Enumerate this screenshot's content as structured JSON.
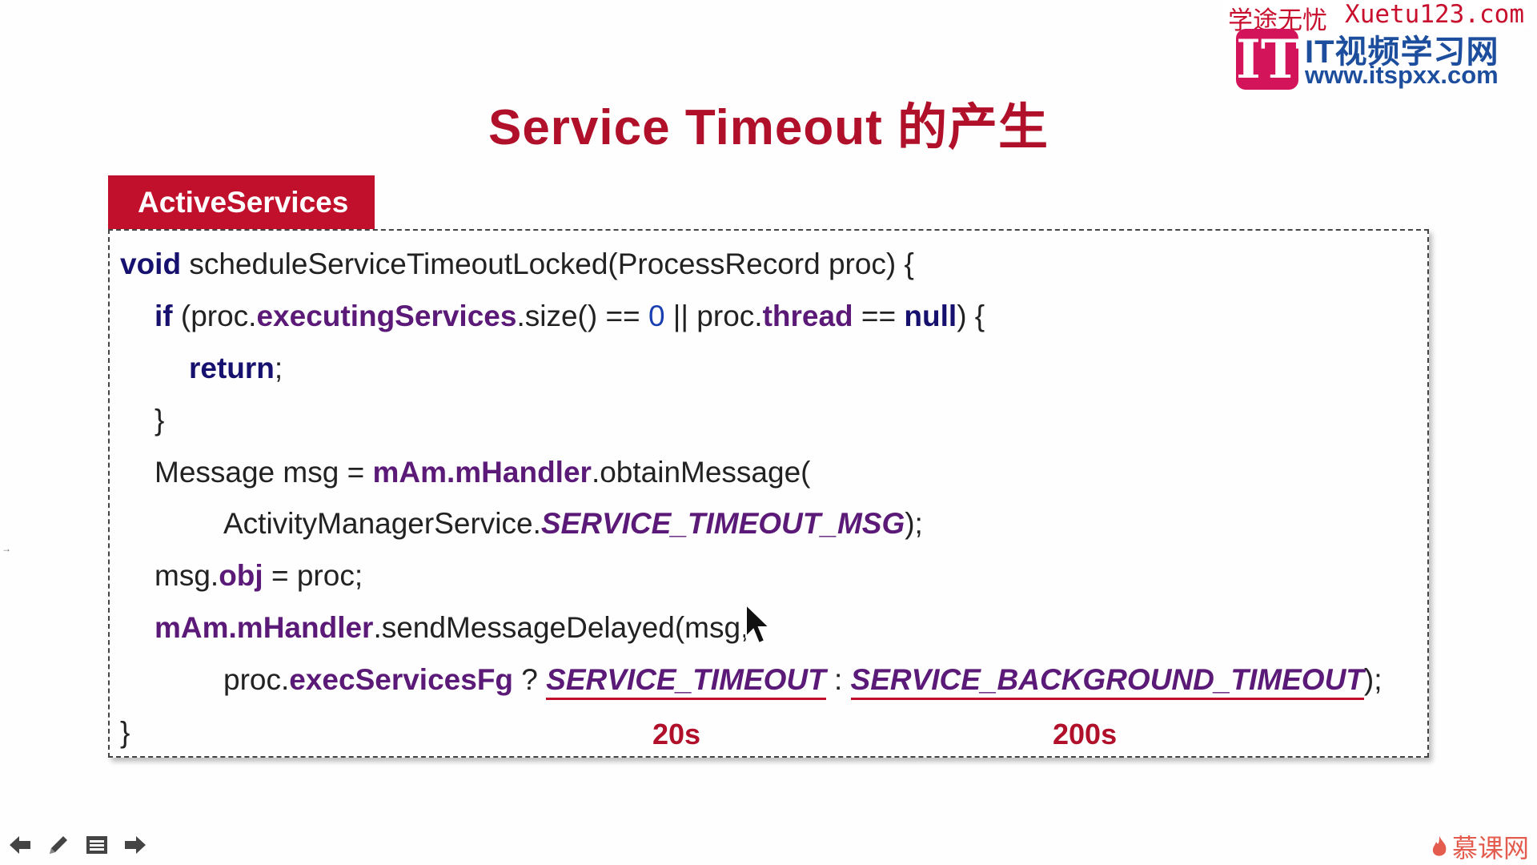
{
  "watermark": {
    "top_cn": "学途无忧",
    "top_url": "Xuetu123.com",
    "logo_letter": "IT",
    "logo_cn": "IT视频学习网",
    "logo_url": "www.itspxx.com"
  },
  "slide": {
    "title": "Service Timeout 的产生",
    "class_tab": "ActiveServices",
    "annotations": {
      "fg_timeout": "20s",
      "bg_timeout": "200s"
    }
  },
  "code": {
    "l1_kw": "void",
    "l1_rest": " scheduleServiceTimeoutLocked(ProcessRecord proc) {",
    "l2_kw": "if",
    "l2_a": " (proc.",
    "l2_fld": "executingServices",
    "l2_b": ".size() == ",
    "l2_num": "0",
    "l2_c": " || proc.",
    "l2_fld2": "thread",
    "l2_d": " == ",
    "l2_kw2": "null",
    "l2_e": ") {",
    "l3_kw": "return",
    "l3_rest": ";",
    "l4": "}",
    "l5_a": "Message msg = ",
    "l5_fld": "mAm.mHandler",
    "l5_b": ".obtainMessage(",
    "l6_a": "ActivityManagerService.",
    "l6_cst": "SERVICE_TIMEOUT_MSG",
    "l6_b": ");",
    "l7_a": "msg.",
    "l7_fld": "obj",
    "l7_b": " = proc;",
    "l8_fld": "mAm.mHandler",
    "l8_b": ".sendMessageDelayed(msg,",
    "l9_a": "proc.",
    "l9_fld": "execServicesFg",
    "l9_b": " ? ",
    "l9_cst1": "SERVICE_TIMEOUT",
    "l9_c": " : ",
    "l9_cst2": "SERVICE_BACKGROUND_TIMEOUT",
    "l9_d": ");",
    "l10": "}"
  },
  "controls": {
    "prev_icon": "arrow-left-icon",
    "pen_icon": "pen-icon",
    "menu_icon": "slides-menu-icon",
    "next_icon": "arrow-right-icon"
  },
  "brand": {
    "name": "慕课网",
    "icon": "flame-icon"
  },
  "colors": {
    "accent": "#c0102c",
    "keyword": "#16116e",
    "field": "#5b1a78",
    "number": "#1a3fb0",
    "watermark_blue": "#1d4e9e"
  }
}
